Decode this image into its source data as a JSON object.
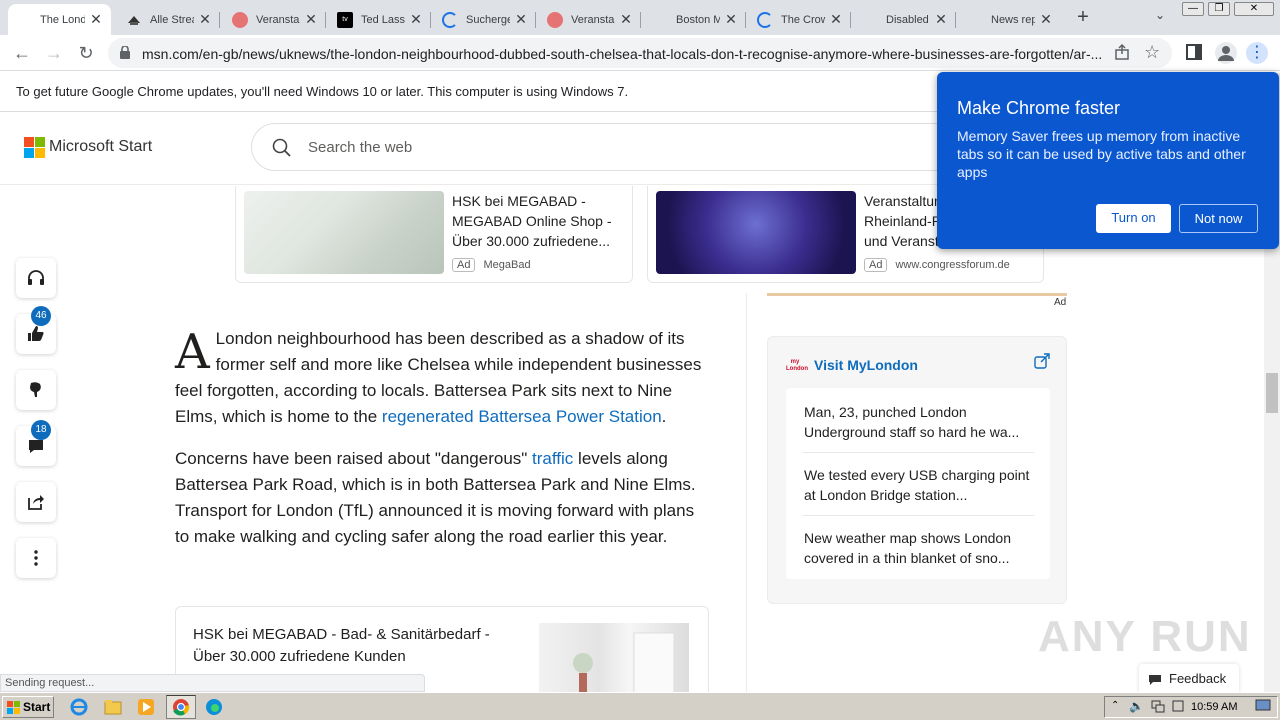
{
  "tabs": [
    {
      "title": "The London neighbourhood",
      "favicon": "microsoft-icon",
      "active": true
    },
    {
      "title": "Alle Streams",
      "favicon": "hat-icon"
    },
    {
      "title": "Veranstaltungen",
      "favicon": "red-circle-icon"
    },
    {
      "title": "Ted Lasso",
      "favicon": "appletv-icon"
    },
    {
      "title": "Suchergebnisse",
      "favicon": "loading-icon"
    },
    {
      "title": "Veranstaltungen",
      "favicon": "red-circle-icon"
    },
    {
      "title": "Boston Marathon",
      "favicon": "microsoft-icon"
    },
    {
      "title": "The Crown",
      "favicon": "loading-icon"
    },
    {
      "title": "Disabled",
      "favicon": "microsoft-icon"
    },
    {
      "title": "News report",
      "favicon": "microsoft-icon"
    }
  ],
  "toolbar": {
    "url": "msn.com/en-gb/news/uknews/the-london-neighbourhood-dubbed-south-chelsea-that-locals-don-t-recognise-anymore-where-businesses-are-forgotten/ar-..."
  },
  "infobar": {
    "text": "To get future Google Chrome updates, you'll need Windows 10 or later. This computer is using Windows 7."
  },
  "header": {
    "brand": "Microsoft Start",
    "search_placeholder": "Search the web"
  },
  "top_ads": [
    {
      "text": "HSK bei MEGABAD - MEGABAD Online Shop - Über 30.000 zufriedene...",
      "tag": "Ad",
      "source": "MegaBad"
    },
    {
      "text": "Veranstaltungen Rheinland-Pfalz - Events und Veranstaltungen",
      "tag": "Ad",
      "source": "www.congressforum.de"
    }
  ],
  "side_actions": {
    "likes": "46",
    "comments": "18"
  },
  "article": {
    "dropcap": "A",
    "p1_a": "London neighbourhood has been described as a shadow of its former self and more like Chelsea while independent businesses feel forgotten, according to locals. Battersea Park sits next to Nine Elms, which is home to the ",
    "p1_link": "regenerated Battersea Power Station",
    "p1_b": ".",
    "p2_a": "Concerns have been raised about \"dangerous\" ",
    "p2_link": "traffic",
    "p2_b": " levels along Battersea Park Road, which is in both Battersea Park and Nine Elms. Transport for London (TfL) announced it is moving forward with plans to make walking and cycling safer along the road earlier this year."
  },
  "inline_ad": {
    "text": "HSK bei MEGABAD - Bad- & Sanitärbedarf - Über 30.000 zufriedene Kunden"
  },
  "right_ad_label": "Ad",
  "mylondon": {
    "logo_text": "my London",
    "title": "Visit MyLondon",
    "items": [
      "Man, 23, punched London Underground staff so hard he wa...",
      "We tested every USB charging point at London Bridge station...",
      "New weather map shows London covered in a thin blanket of sno..."
    ]
  },
  "popup": {
    "title": "Make Chrome faster",
    "body": "Memory Saver frees up memory from inactive tabs so it can be used by active tabs and other apps",
    "turn_on": "Turn on",
    "not_now": "Not now"
  },
  "status_text": "Sending request...",
  "feedback_label": "Feedback",
  "watermark": "ANY RUN",
  "taskbar": {
    "start_label": "Start",
    "clock": "10:59 AM"
  }
}
